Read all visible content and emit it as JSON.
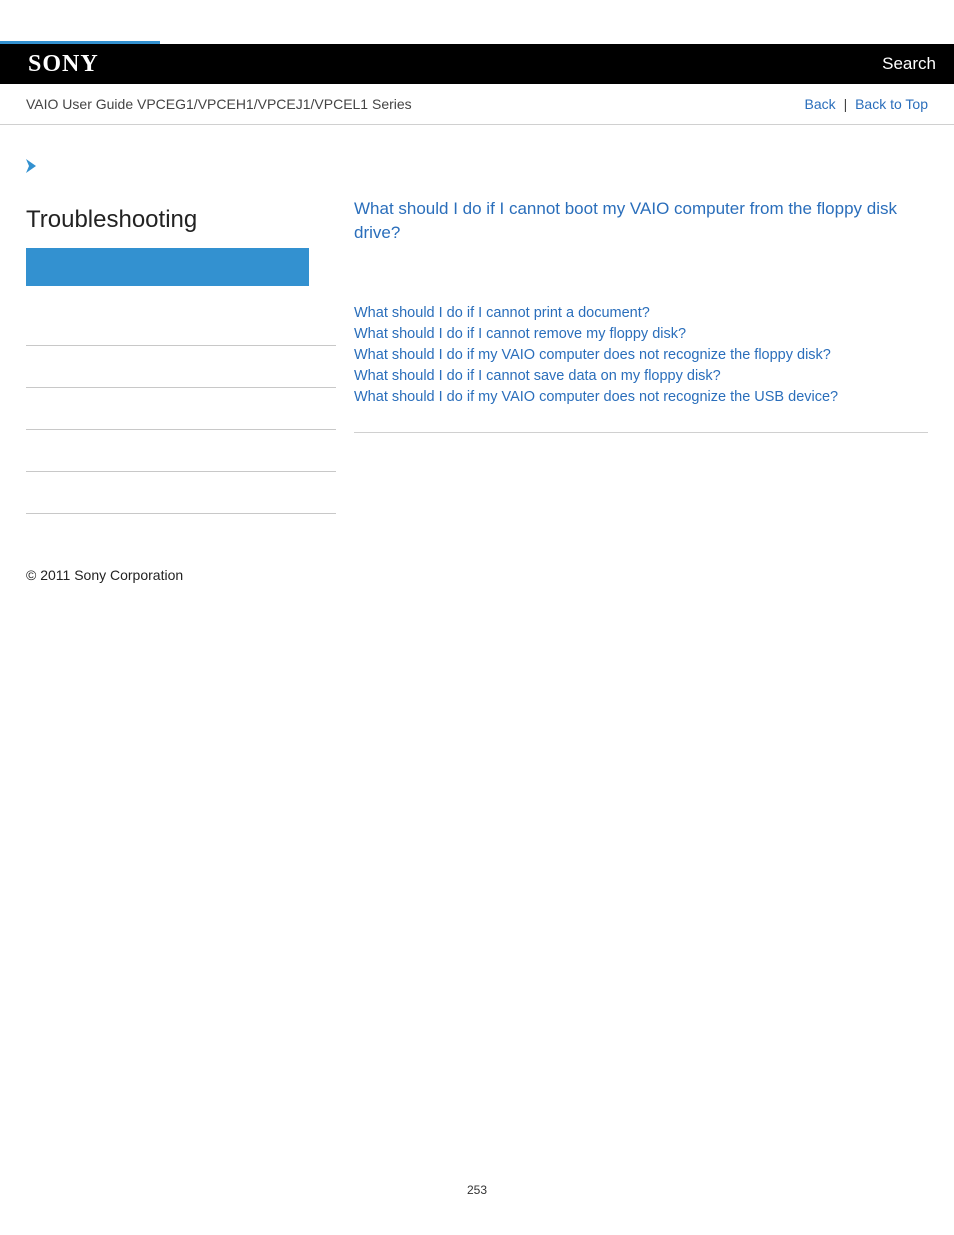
{
  "header": {
    "logo_text": "SONY",
    "search_label": "Search"
  },
  "breadcrumb": {
    "title": "VAIO User Guide VPCEG1/VPCEH1/VPCEJ1/VPCEL1 Series",
    "back_label": "Back",
    "top_label": "Back to Top",
    "separator": "|"
  },
  "sidebar": {
    "title": "Troubleshooting"
  },
  "main": {
    "title": "What should I do if I cannot boot my VAIO computer from the floppy disk drive?",
    "links": [
      "What should I do if I cannot print a document?",
      "What should I do if I cannot remove my floppy disk?",
      "What should I do if my VAIO computer does not recognize the floppy disk?",
      "What should I do if I cannot save data on my floppy disk?",
      "What should I do if my VAIO computer does not recognize the USB device?"
    ]
  },
  "footer": {
    "copyright": "© 2011 Sony Corporation",
    "page_number": "253"
  }
}
